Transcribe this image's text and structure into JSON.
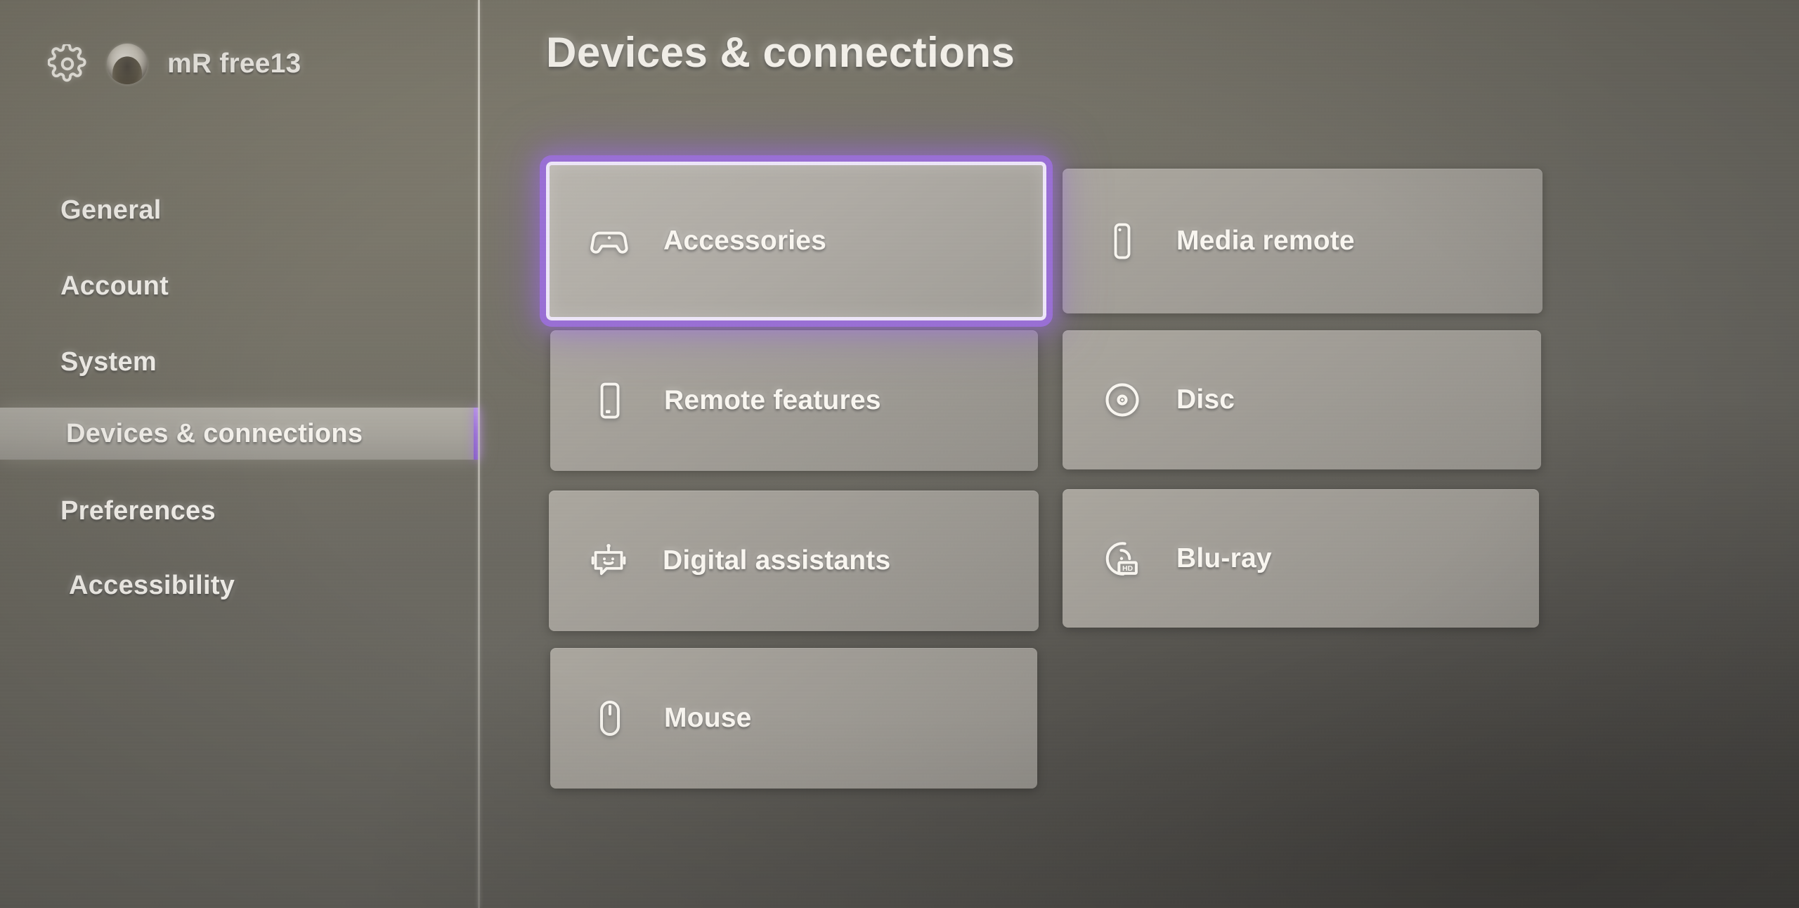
{
  "header": {
    "gear_icon": "gear-icon",
    "avatar_icon": "avatar",
    "gamertag": "mR free13"
  },
  "sidebar": {
    "items": [
      {
        "label": "General",
        "selected": false,
        "indent": false
      },
      {
        "label": "Account",
        "selected": false,
        "indent": false
      },
      {
        "label": "System",
        "selected": false,
        "indent": false
      },
      {
        "label": "Devices & connections",
        "selected": true,
        "indent": false
      },
      {
        "label": "Preferences",
        "selected": false,
        "indent": false
      },
      {
        "label": "Accessibility",
        "selected": false,
        "indent": true
      }
    ],
    "selected_index": 3,
    "accent_color": "#9a6fd6"
  },
  "main": {
    "title": "Devices & connections",
    "tiles": [
      {
        "label": "Accessories",
        "icon": "gamepad-icon",
        "focused": true
      },
      {
        "label": "Media remote",
        "icon": "media-remote-icon",
        "focused": false
      },
      {
        "label": "Remote features",
        "icon": "mobile-phone-icon",
        "focused": false
      },
      {
        "label": "Disc",
        "icon": "disc-icon",
        "focused": false
      },
      {
        "label": "Digital assistants",
        "icon": "chat-bot-icon",
        "focused": false
      },
      {
        "label": "Blu-ray",
        "icon": "bluray-hd-disc-icon",
        "focused": false
      },
      {
        "label": "Mouse",
        "icon": "mouse-icon",
        "focused": false
      }
    ],
    "focus_ring_color": "#9a6fd6",
    "focus_ring_inner_color": "#f0e8fb"
  }
}
